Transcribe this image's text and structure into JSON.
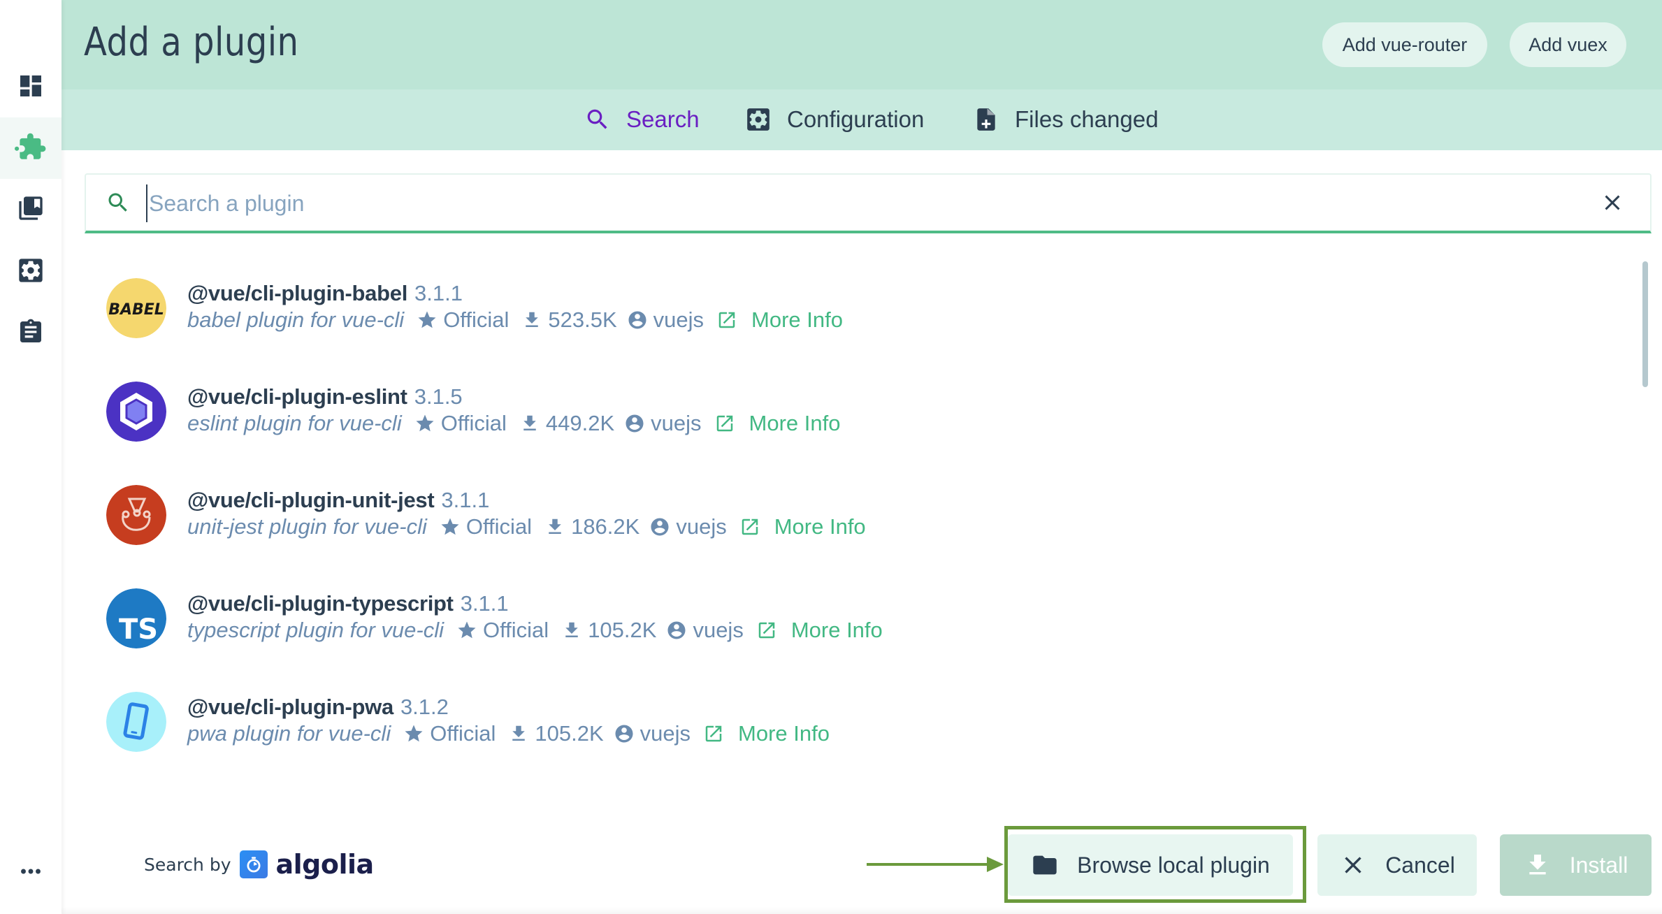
{
  "sidebar": {
    "items": [
      {
        "name": "dashboard",
        "icon": "dashboard-icon",
        "active": false
      },
      {
        "name": "plugins",
        "icon": "puzzle-icon",
        "active": true
      },
      {
        "name": "dependencies",
        "icon": "book-icon",
        "active": false
      },
      {
        "name": "configuration",
        "icon": "gear-icon",
        "active": false
      },
      {
        "name": "tasks",
        "icon": "clipboard-icon",
        "active": false
      }
    ],
    "more_icon": "more-dots-icon"
  },
  "header": {
    "title": "Add a plugin",
    "buttons": [
      {
        "label": "Add vue-router"
      },
      {
        "label": "Add vuex"
      }
    ]
  },
  "tabs": [
    {
      "label": "Search",
      "icon": "search-icon",
      "active": true
    },
    {
      "label": "Configuration",
      "icon": "gear-icon",
      "active": false
    },
    {
      "label": "Files changed",
      "icon": "file-plus-icon",
      "active": false
    }
  ],
  "search": {
    "value": "",
    "placeholder": "Search a plugin"
  },
  "plugins": [
    {
      "name": "@vue/cli-plugin-babel",
      "version": "3.1.1",
      "description": "babel plugin for vue-cli",
      "badge": "Official",
      "downloads": "523.5K",
      "owner": "vuejs",
      "link": "More Info",
      "avatar": "babel"
    },
    {
      "name": "@vue/cli-plugin-eslint",
      "version": "3.1.5",
      "description": "eslint plugin for vue-cli",
      "badge": "Official",
      "downloads": "449.2K",
      "owner": "vuejs",
      "link": "More Info",
      "avatar": "eslint"
    },
    {
      "name": "@vue/cli-plugin-unit-jest",
      "version": "3.1.1",
      "description": "unit-jest plugin for vue-cli",
      "badge": "Official",
      "downloads": "186.2K",
      "owner": "vuejs",
      "link": "More Info",
      "avatar": "jest"
    },
    {
      "name": "@vue/cli-plugin-typescript",
      "version": "3.1.1",
      "description": "typescript plugin for vue-cli",
      "badge": "Official",
      "downloads": "105.2K",
      "owner": "vuejs",
      "link": "More Info",
      "avatar": "typescript"
    },
    {
      "name": "@vue/cli-plugin-pwa",
      "version": "3.1.2",
      "description": "pwa plugin for vue-cli",
      "badge": "Official",
      "downloads": "105.2K",
      "owner": "vuejs",
      "link": "More Info",
      "avatar": "pwa"
    }
  ],
  "avatar_text": {
    "babel": "BABEL",
    "typescript": "TS"
  },
  "footer": {
    "search_by": "Search by",
    "algolia": "algolia",
    "browse_label": "Browse local plugin",
    "cancel_label": "Cancel",
    "install_label": "Install"
  },
  "colors": {
    "accent": "#42b883",
    "header_bg": "#bde5d6",
    "tab_bg": "#c8eadf",
    "active_tab": "#6a1fc2",
    "highlight": "#6b9a3c",
    "text": "#2c3e50",
    "muted": "#6b8bae"
  }
}
